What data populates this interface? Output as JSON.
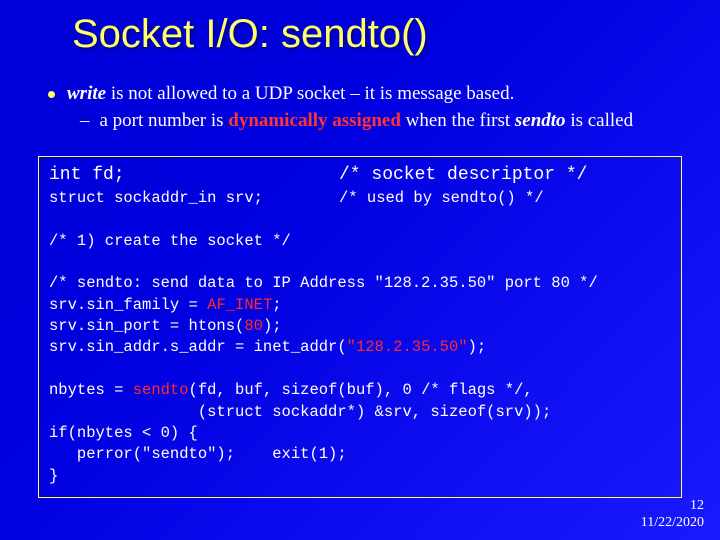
{
  "title": "Socket I/O: sendto()",
  "bullet": {
    "write": "write",
    "text1": " is not allowed to a UDP socket – it is message based.",
    "sub_pre": "a port number is ",
    "sub_bold": "dynamically assigned",
    "sub_mid": " when the first ",
    "sub_sendto": "sendto",
    "sub_post": " is called"
  },
  "code": {
    "l1a": "int fd;",
    "l1b": "/* socket descriptor */",
    "l2a": "struct sockaddr_in srv;",
    "l2b": "/* used by sendto() */",
    "blank": " ",
    "l3": "/* 1) create the socket */",
    "l4": "/* sendto: send data to IP Address \"128.2.35.50\" port 80 */",
    "l5a": "srv.sin_family = ",
    "l5r": "AF_INET",
    "l5b": ";",
    "l6a": "srv.sin_port = htons(",
    "l6r": "80",
    "l6b": ");",
    "l7a": "srv.sin_addr.s_addr = inet_addr(",
    "l7r": "\"128.2.35.50\"",
    "l7b": ");",
    "l8a": "nbytes = ",
    "l8r": "sendto",
    "l8b": "(fd, buf, sizeof(buf), 0 /* flags */,",
    "l9": "                (struct sockaddr*) &srv, sizeof(srv));",
    "l10": "if(nbytes < 0) {",
    "l11": "   perror(\"sendto\");    exit(1);",
    "l12": "}"
  },
  "footer": {
    "num": "12",
    "date": "11/22/2020"
  }
}
